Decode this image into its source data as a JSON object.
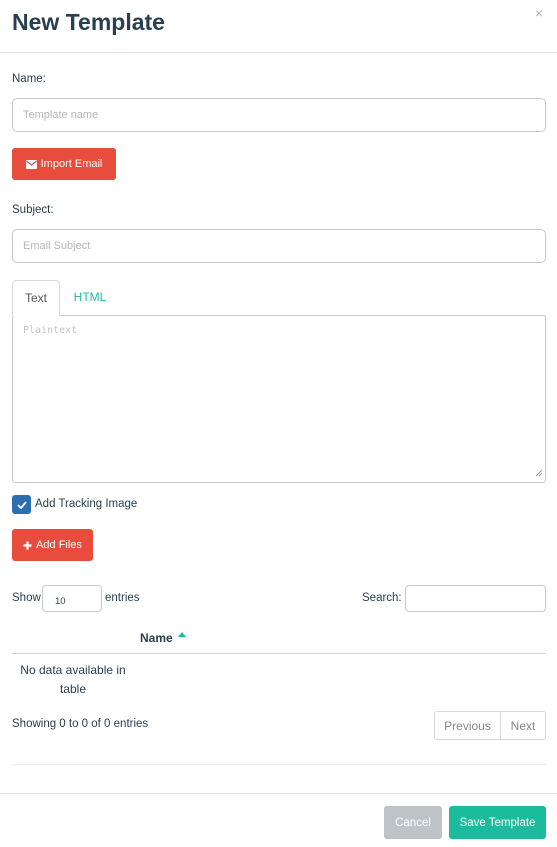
{
  "modal": {
    "title": "New Template",
    "close_glyph": "×"
  },
  "form": {
    "name_label": "Name:",
    "name_placeholder": "Template name",
    "import_email_label": "Import Email",
    "subject_label": "Subject:",
    "subject_placeholder": "Email Subject",
    "tabs": [
      {
        "label": "Text",
        "active": true
      },
      {
        "label": "HTML",
        "active": false
      }
    ],
    "plaintext_placeholder": "Plaintext",
    "tracking_checkbox": {
      "label": "Add Tracking Image",
      "checked": true
    },
    "add_files_label": "Add Files"
  },
  "attachments_table": {
    "show_label": "Show",
    "entries_value": "10",
    "entries_label": "entries",
    "search_label": "Search:",
    "search_value": "",
    "columns": [
      "Name"
    ],
    "sort_direction": "ascending",
    "empty_message": "No data available in table",
    "info_text": "Showing 0 to 0 of 0 entries",
    "previous_label": "Previous",
    "next_label": "Next"
  },
  "footer": {
    "cancel_label": "Cancel",
    "save_label": "Save Template"
  },
  "colors": {
    "primary_text": "#283f50",
    "danger": "#e74c3c",
    "accent": "#1abc9c",
    "checkbox": "#2b6fb0",
    "cancel_gray": "#bdc3c7"
  },
  "icons": {
    "import_email": "envelope-icon",
    "add_files": "plus-icon",
    "checkbox": "check-icon",
    "sort": "sort-ascending-icon"
  }
}
